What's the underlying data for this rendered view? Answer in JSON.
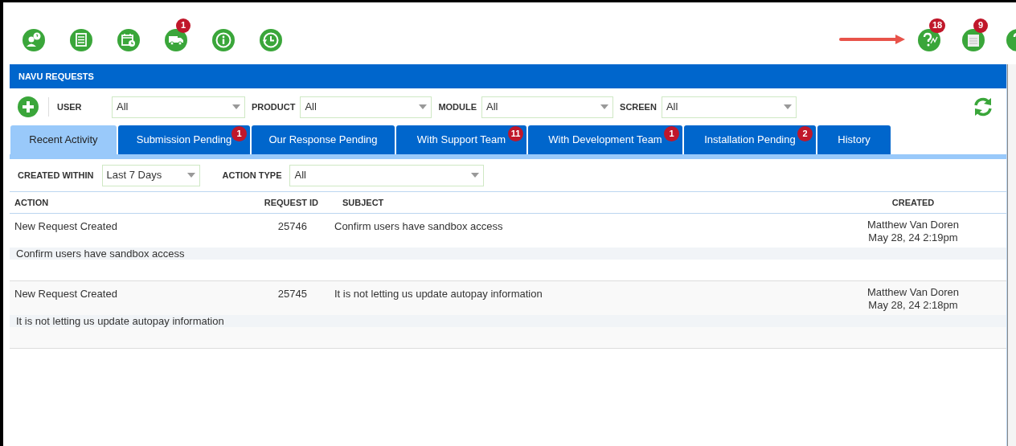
{
  "toolbar_left": [
    {
      "kind": "person-question"
    },
    {
      "kind": "checklist"
    },
    {
      "kind": "calendar-clock"
    },
    {
      "kind": "truck",
      "badge": "1"
    },
    {
      "kind": "info"
    },
    {
      "kind": "history"
    }
  ],
  "toolbar_right": [
    {
      "kind": "question-wave",
      "badge": "18"
    },
    {
      "kind": "window",
      "badge": "9"
    },
    {
      "kind": "help"
    }
  ],
  "panel": {
    "title": "NAVU REQUESTS",
    "filters": [
      {
        "label": "USER",
        "value": "All"
      },
      {
        "label": "PRODUCT",
        "value": "All"
      },
      {
        "label": "MODULE",
        "value": "All"
      },
      {
        "label": "SCREEN",
        "value": "All"
      }
    ],
    "tabs": [
      {
        "label": "Recent Activity",
        "selected": true
      },
      {
        "label": "Submission Pending",
        "selected": false,
        "badge": "1"
      },
      {
        "label": "Our Response Pending",
        "selected": false
      },
      {
        "label": "With Support Team",
        "selected": false,
        "badge": "11"
      },
      {
        "label": "With Development Team",
        "selected": false,
        "badge": "1"
      },
      {
        "label": "Installation Pending",
        "selected": false,
        "badge": "2"
      },
      {
        "label": "History",
        "selected": false
      }
    ],
    "subfilters": [
      {
        "label": "CREATED WITHIN",
        "value": "Last 7 Days"
      },
      {
        "label": "ACTION TYPE",
        "value": "All"
      }
    ],
    "table": {
      "columns": [
        "ACTION",
        "REQUEST ID",
        "SUBJECT",
        "CREATED"
      ],
      "rows": [
        {
          "action": "New Request Created",
          "request_id": "25746",
          "subject": "Confirm users have sandbox access",
          "created_by": "Matthew Van Doren",
          "created_at": "May 28, 24 2:19pm",
          "description": "Confirm users have sandbox access"
        },
        {
          "action": "New Request Created",
          "request_id": "25745",
          "subject": "It is not letting us update autopay information",
          "created_by": "Matthew Van Doren",
          "created_at": "May 28, 24 2:18pm",
          "description": "It is not letting us update autopay information"
        }
      ]
    }
  }
}
